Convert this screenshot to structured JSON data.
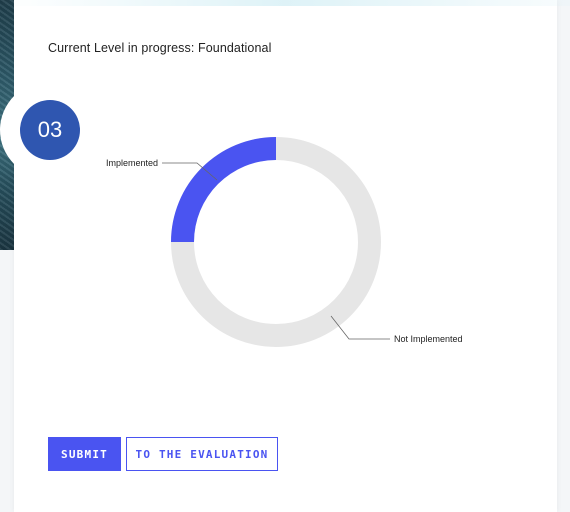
{
  "header": {
    "level_text": "Current Level in progress: Foundational"
  },
  "step": {
    "number": "03"
  },
  "donut": {
    "type": "pie",
    "segments": [
      {
        "label": "Implemented",
        "value": 25,
        "color": "#4a54f1"
      },
      {
        "label": "Not Implemented",
        "value": 75,
        "color": "#e6e6e6"
      }
    ]
  },
  "actions": {
    "submit_label": "SUBMIT",
    "evaluation_label": "TO THE EVALUATION"
  },
  "colors": {
    "accent": "#4a54f1",
    "badge": "#2f56b0",
    "track": "#e6e6e6"
  }
}
